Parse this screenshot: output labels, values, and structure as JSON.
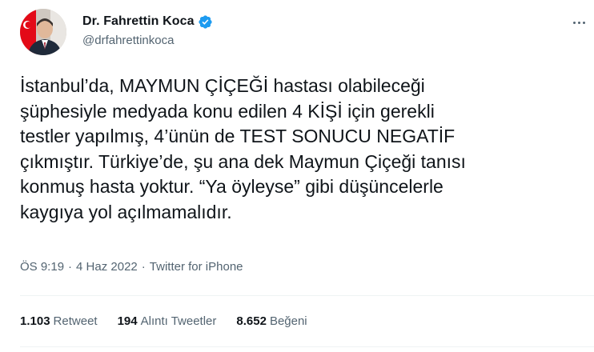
{
  "author": {
    "display_name": "Dr. Fahrettin Koca",
    "handle": "@drfahrettinkoca",
    "verified_icon": "verified-badge-icon"
  },
  "tweet": {
    "text": "İstanbul’da, MAYMUN ÇİÇEĞİ hastası olabileceği\nşüphesiyle medyada konu edilen 4 KİŞİ için gerekli\ntestler yapılmış, 4’ünün de TEST SONUCU NEGATİF\nçıkmıştır. Türkiye’de, şu ana dek Maymun Çiçeği tanısı\nkonmuş hasta yoktur. “Ya öyleyse” gibi düşüncelerle\nkaygıya yol açılmamalıdır."
  },
  "meta": {
    "time": "ÖS 9:19",
    "separator": "·",
    "date": "4 Haz 2022",
    "source": "Twitter for iPhone"
  },
  "stats": {
    "retweets": {
      "count": "1.103",
      "label": "Retweet"
    },
    "quotes": {
      "count": "194",
      "label": "Alıntı Tweetler"
    },
    "likes": {
      "count": "8.652",
      "label": "Beğeni"
    }
  },
  "colors": {
    "text_primary": "#0f1419",
    "text_secondary": "#536471",
    "verified_blue": "#1d9bf0",
    "divider": "#eff3f4",
    "avatar_flag_red": "#e30a17"
  }
}
